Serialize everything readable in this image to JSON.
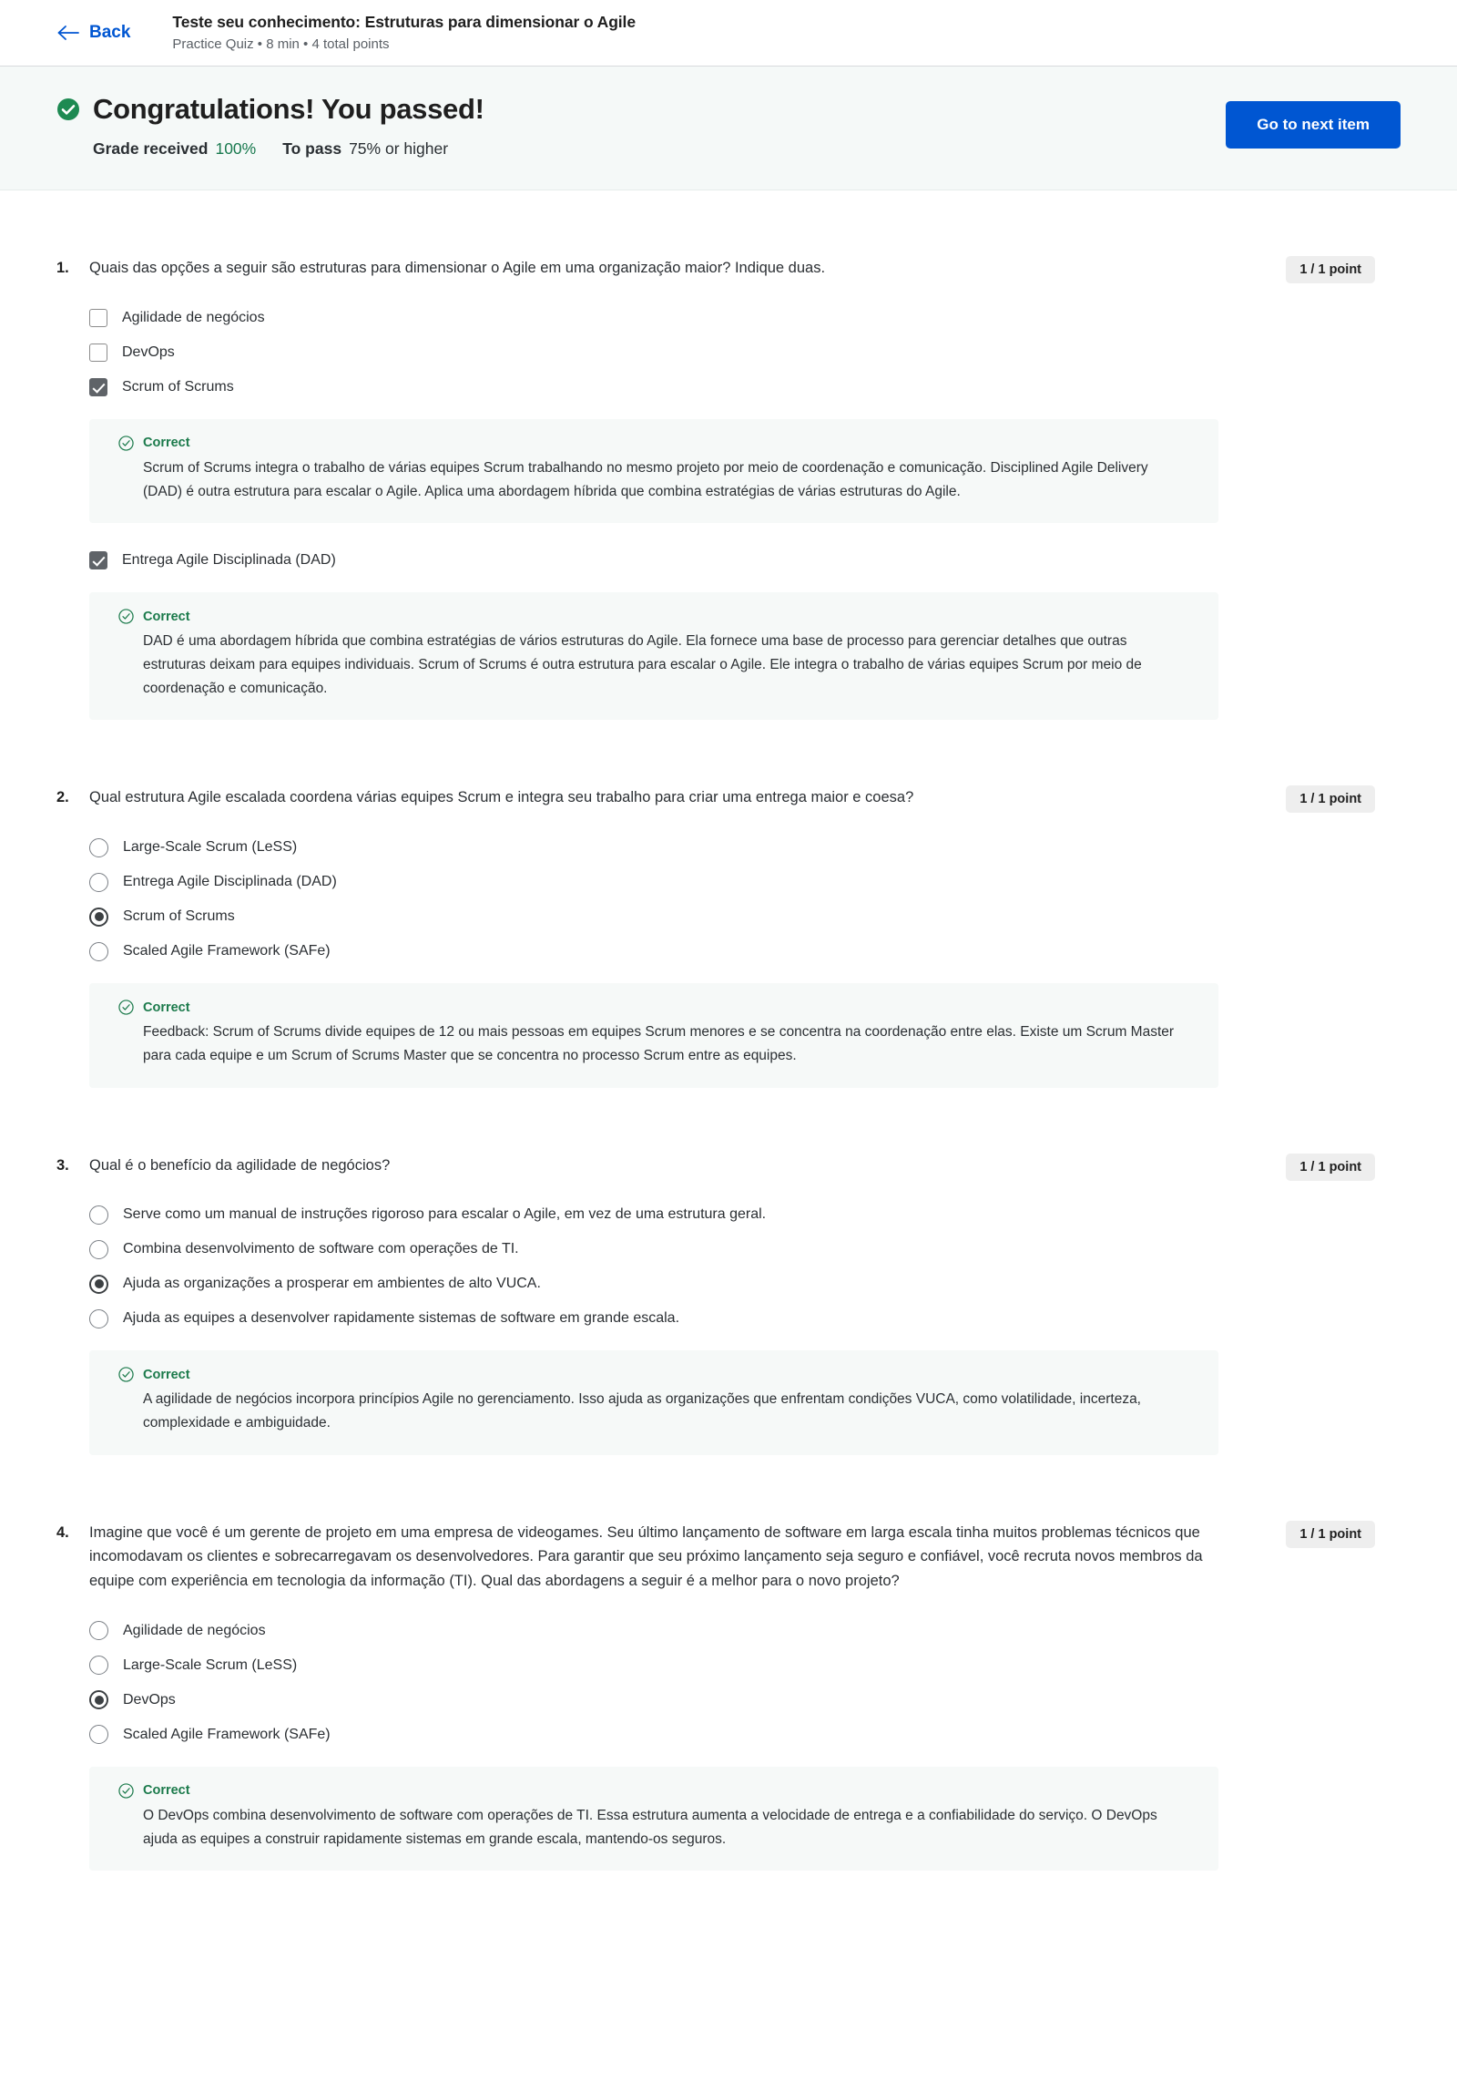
{
  "header": {
    "back_label": "Back",
    "back_icon": "arrow-left-icon",
    "quiz_title": "Teste seu conhecimento: Estruturas para dimensionar o Agile",
    "quiz_meta": "Practice Quiz • 8 min • 4 total points"
  },
  "banner": {
    "status_icon": "check-circle-solid-icon",
    "heading": "Congratulations! You passed!",
    "grade_label": "Grade received",
    "grade_value": "100%",
    "pass_label": "To pass",
    "pass_value": "75% or higher",
    "next_button": "Go to next item",
    "accent_blue": "#0056D2",
    "accent_green": "#18794E",
    "background": "#F5F9F8"
  },
  "questions": [
    {
      "number": "1.",
      "text": "Quais das opções a seguir são estruturas para dimensionar o Agile em uma organização maior? Indique duas.",
      "points": "1 / 1 point",
      "input_type": "checkbox",
      "options": [
        {
          "label": "Agilidade de negócios",
          "selected": false
        },
        {
          "label": "DevOps",
          "selected": false
        },
        {
          "label": "Scrum of Scrums",
          "selected": true,
          "feedback": {
            "status": "Correct",
            "icon": "check-circle-outline-icon",
            "text": "Scrum of Scrums integra o trabalho de várias equipes Scrum trabalhando no mesmo projeto por meio de coordenação e comunicação. Disciplined Agile Delivery (DAD) é outra estrutura para escalar o Agile. Aplica uma abordagem híbrida que combina estratégias de várias estruturas do Agile."
          }
        },
        {
          "label": "Entrega Agile Disciplinada (DAD)",
          "selected": true,
          "feedback": {
            "status": "Correct",
            "icon": "check-circle-outline-icon",
            "text": "DAD é uma abordagem híbrida que combina estratégias de vários estruturas do Agile. Ela fornece uma base de processo para gerenciar detalhes que outras estruturas deixam para equipes individuais. Scrum of Scrums é outra estrutura para escalar o Agile. Ele integra o trabalho de várias equipes Scrum por meio de coordenação e comunicação."
          }
        }
      ]
    },
    {
      "number": "2.",
      "text": "Qual estrutura Agile escalada coordena várias equipes Scrum e integra seu trabalho para criar uma entrega maior e coesa?",
      "points": "1 / 1 point",
      "input_type": "radio",
      "options": [
        {
          "label": "Large-Scale Scrum (LeSS)",
          "selected": false
        },
        {
          "label": "Entrega Agile Disciplinada (DAD)",
          "selected": false
        },
        {
          "label": "Scrum of Scrums",
          "selected": true
        },
        {
          "label": "Scaled Agile Framework (SAFe)",
          "selected": false
        }
      ],
      "feedback": {
        "status": "Correct",
        "icon": "check-circle-outline-icon",
        "text": "Feedback: Scrum of Scrums divide equipes de 12 ou mais pessoas em equipes Scrum menores e se concentra na coordenação entre elas. Existe um Scrum Master para cada equipe e um Scrum of Scrums Master que se concentra no processo Scrum entre as equipes."
      }
    },
    {
      "number": "3.",
      "text": "Qual é o benefício da agilidade de negócios?",
      "points": "1 / 1 point",
      "input_type": "radio",
      "options": [
        {
          "label": "Serve como um manual de instruções rigoroso para escalar o Agile, em vez de uma estrutura geral.",
          "selected": false
        },
        {
          "label": "Combina desenvolvimento de software com operações de TI.",
          "selected": false
        },
        {
          "label": "Ajuda as organizações a prosperar em ambientes de alto VUCA.",
          "selected": true
        },
        {
          "label": "Ajuda as equipes a desenvolver rapidamente sistemas de software em grande escala.",
          "selected": false
        }
      ],
      "feedback": {
        "status": "Correct",
        "icon": "check-circle-outline-icon",
        "text": "A agilidade de negócios incorpora princípios Agile no gerenciamento. Isso ajuda as organizações que enfrentam condições VUCA, como volatilidade, incerteza, complexidade e ambiguidade."
      }
    },
    {
      "number": "4.",
      "text": "Imagine que você é um gerente de projeto em uma empresa de videogames. Seu último lançamento de software em larga escala tinha muitos problemas técnicos que incomodavam os clientes e sobrecarregavam os desenvolvedores. Para garantir que seu próximo lançamento seja seguro e confiável, você recruta novos membros da equipe com experiência em tecnologia da informação (TI). Qual das abordagens a seguir é a melhor para o novo projeto?",
      "points": "1 / 1 point",
      "input_type": "radio",
      "options": [
        {
          "label": "Agilidade de negócios",
          "selected": false
        },
        {
          "label": "Large-Scale Scrum (LeSS)",
          "selected": false
        },
        {
          "label": "DevOps",
          "selected": true
        },
        {
          "label": "Scaled Agile Framework (SAFe)",
          "selected": false
        }
      ],
      "feedback": {
        "status": "Correct",
        "icon": "check-circle-outline-icon",
        "text": "O DevOps combina desenvolvimento de software com operações de TI. Essa estrutura aumenta a velocidade de entrega e a confiabilidade do serviço. O DevOps ajuda as equipes a construir rapidamente sistemas em grande escala, mantendo-os seguros."
      }
    }
  ]
}
